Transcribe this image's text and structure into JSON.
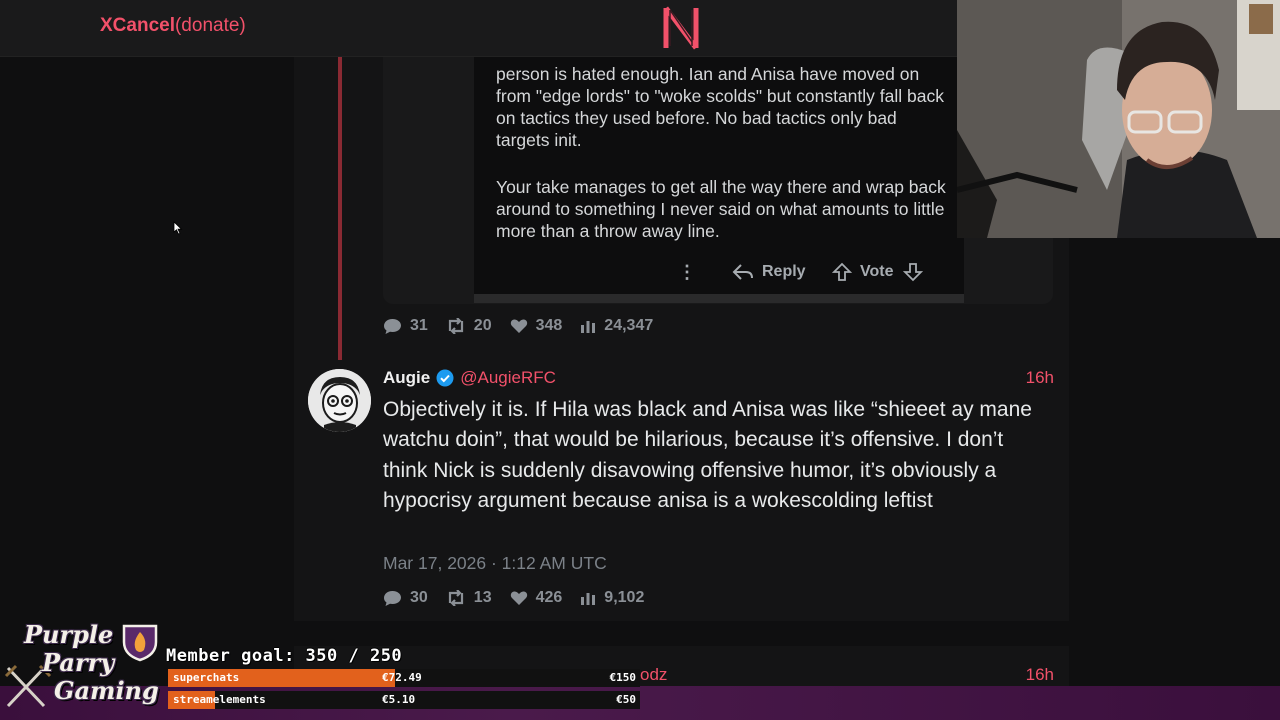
{
  "topbar": {
    "brand_main": "XCancel",
    "brand_donate": "(donate)",
    "logo_letter": "N"
  },
  "quoted_post": {
    "paragraph1": "person is hated enough. Ian and Anisa have moved on from \"edge lords\" to \"woke scolds\" but constantly fall back on tactics they used before. No bad tactics only bad targets init.",
    "paragraph2": "Your take manages to get all the way there and wrap back around to something I never said on what amounts to little more than a throw away line.",
    "actions": {
      "menu": "⋮",
      "reply": "Reply",
      "vote": "Vote"
    }
  },
  "parent_stats": {
    "replies": "31",
    "retweets": "20",
    "likes": "348",
    "views": "24,347"
  },
  "tweet": {
    "display_name": "Augie",
    "handle": "@AugieRFC",
    "age": "16h",
    "text": "Objectively it is. If Hila was black and Anisa was like “shieeet ay mane watchu doin”, that would be hilarious, because it’s offensive. I don’t think Nick is suddenly disavowing offensive humor, it’s obviously a hypocrisy argument because anisa is a wokescolding leftist",
    "date": "Mar 17, 2026 · 1:12 AM UTC",
    "stats": {
      "replies": "30",
      "retweets": "13",
      "likes": "426",
      "views": "9,102"
    }
  },
  "next_tweet": {
    "handle_fragment": "odz",
    "age": "16h"
  },
  "overlay": {
    "logo_lines": [
      "Purple",
      "Parry",
      "Gaming"
    ],
    "member_goal": "Member goal: 350 / 250",
    "bars": [
      {
        "label": "superchats",
        "current": "€72.49",
        "target": "€150",
        "progress": 0.48
      },
      {
        "label": "streamelements",
        "current": "€5.10",
        "target": "€50",
        "progress": 0.1
      }
    ]
  },
  "colors": {
    "accent": "#f2516a",
    "thread_line": "#8a2a33",
    "bar_fill": "#e2611c",
    "verified": "#1d9bf0"
  }
}
